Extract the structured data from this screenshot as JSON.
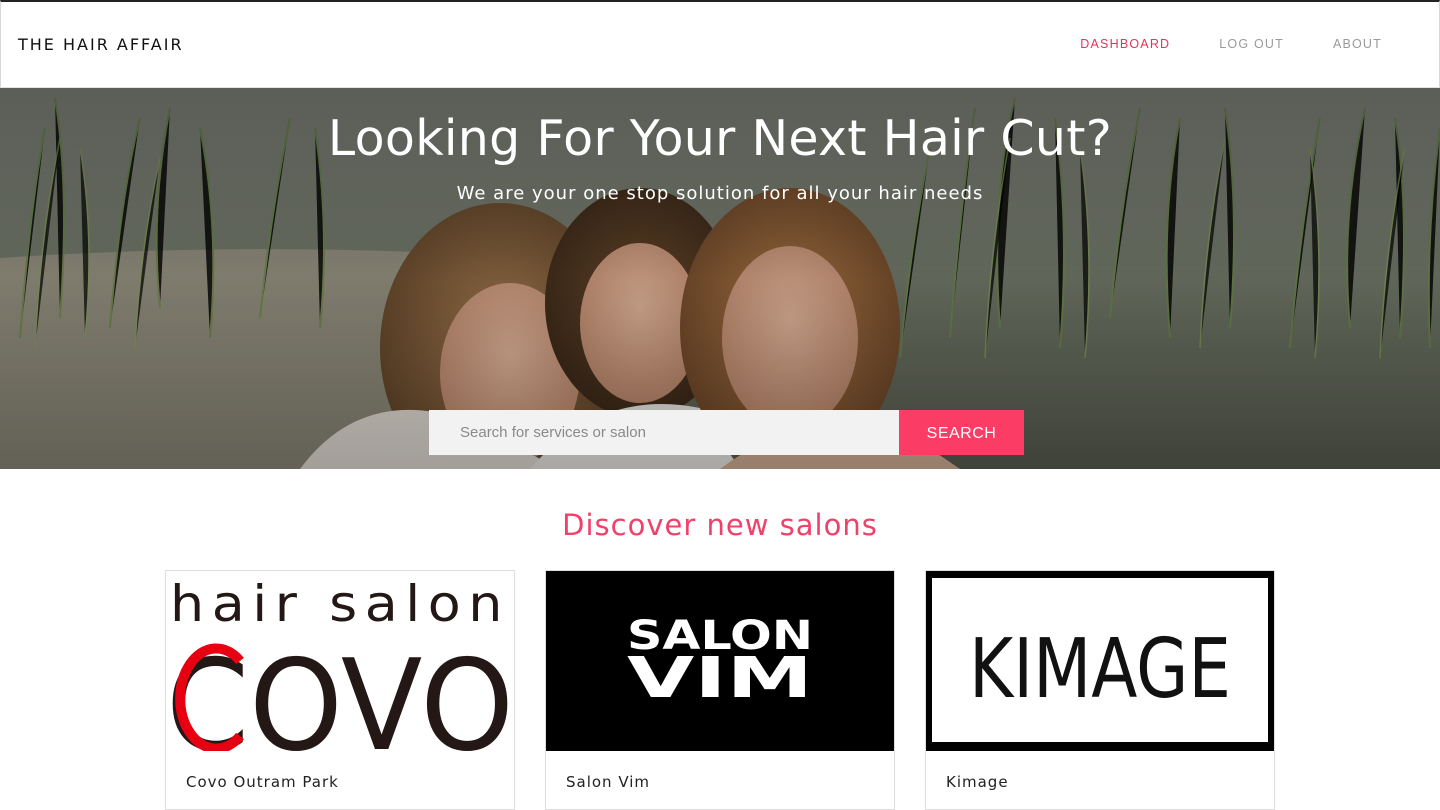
{
  "header": {
    "brand": "THE HAIR AFFAIR",
    "nav": [
      {
        "label": "DASHBOARD",
        "active": true
      },
      {
        "label": "LOG OUT",
        "active": false
      },
      {
        "label": "ABOUT",
        "active": false
      }
    ]
  },
  "hero": {
    "title": "Looking For Your Next Hair Cut?",
    "subtitle": "We are your one stop solution for all your hair needs",
    "search": {
      "placeholder": "Search for services or salon",
      "value": "",
      "button_label": "SEARCH"
    }
  },
  "discover": {
    "title": "Discover new salons",
    "salons": [
      {
        "name": "Covo Outram Park",
        "logo_text_top": "hair salon",
        "logo_text_main": "COVO"
      },
      {
        "name": "Salon Vim",
        "logo_text_top": "SALON",
        "logo_text_main": "VIM"
      },
      {
        "name": "Kimage",
        "logo_text_main": "KIMAGE"
      }
    ]
  },
  "colors": {
    "accent": "#fb3d65",
    "nav_active": "#e8305a",
    "nav_inactive": "#9a9a9a"
  }
}
